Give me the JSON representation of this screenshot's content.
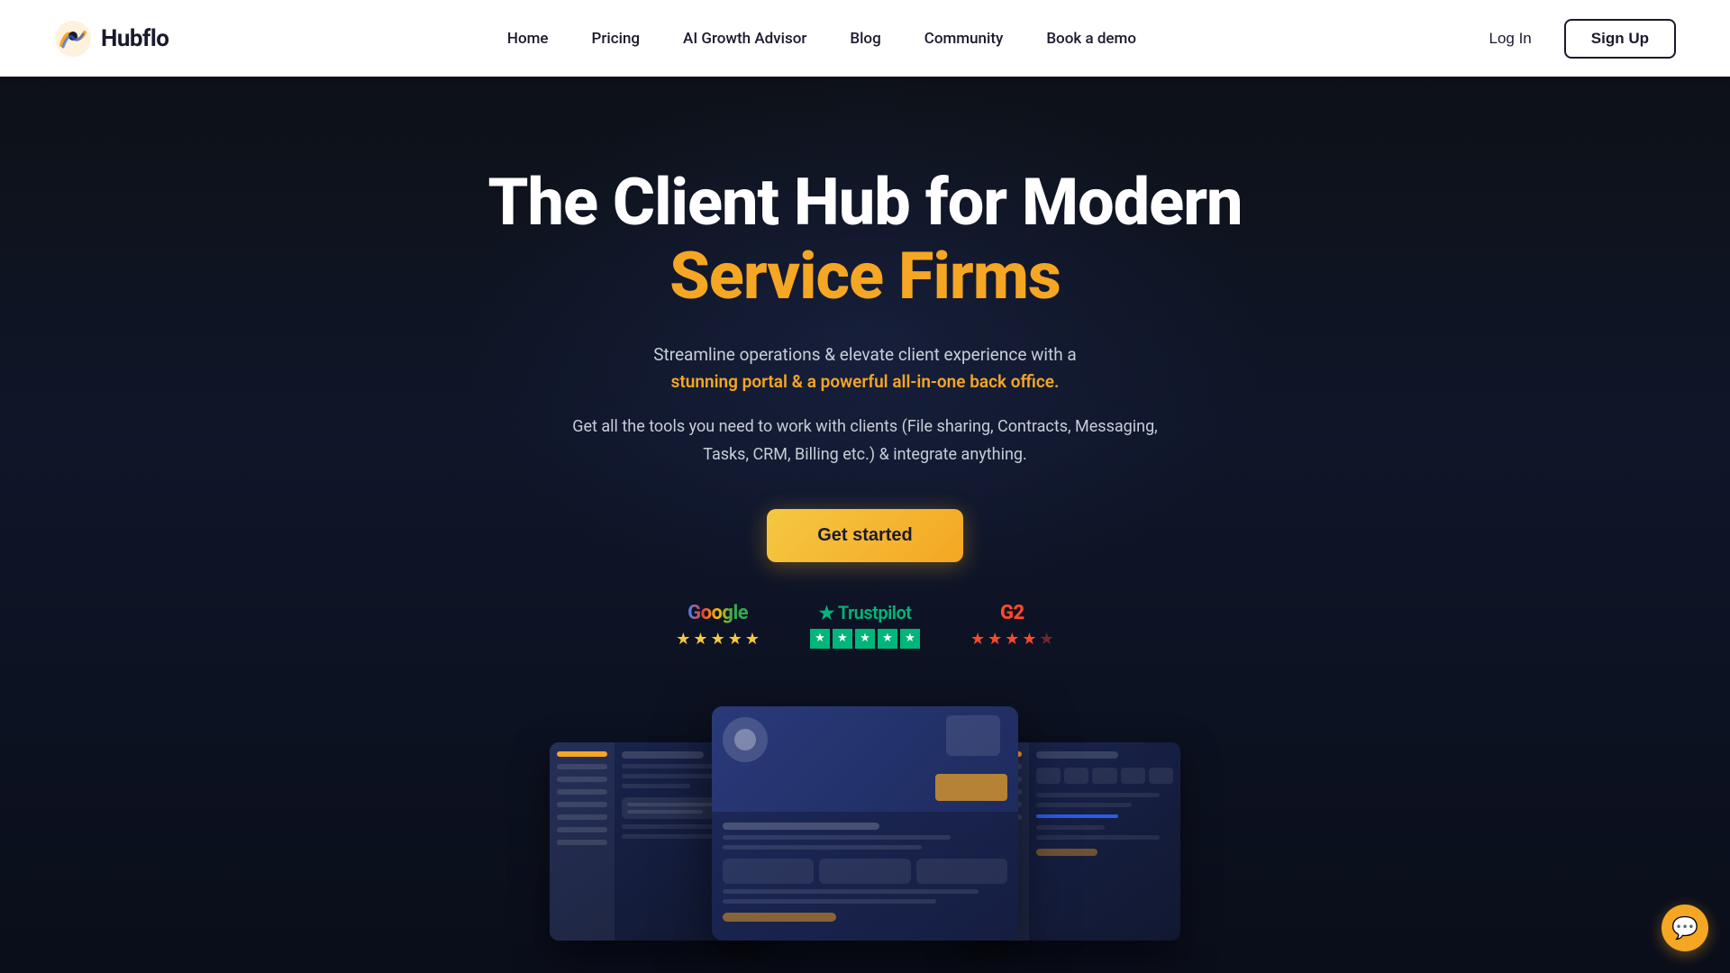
{
  "navbar": {
    "logo_text": "Hubflo",
    "nav_items": [
      {
        "label": "Home",
        "id": "home"
      },
      {
        "label": "Pricing",
        "id": "pricing"
      },
      {
        "label": "AI Growth Advisor",
        "id": "ai-growth"
      },
      {
        "label": "Blog",
        "id": "blog"
      },
      {
        "label": "Community",
        "id": "community"
      },
      {
        "label": "Book a demo",
        "id": "book-demo"
      }
    ],
    "login_label": "Log In",
    "signup_label": "Sign Up"
  },
  "hero": {
    "title_line1": "The Client Hub for Modern",
    "title_line2": "Service Firms",
    "subtitle_plain": "Streamline operations & elevate client experience with a",
    "subtitle_accent": "stunning portal & a powerful all-in-one back office.",
    "description": "Get all the tools you need to work with clients (File sharing, Contracts, Messaging, Tasks, CRM, Billing etc.) & integrate anything.",
    "cta_label": "Get started",
    "ratings": [
      {
        "id": "google",
        "name": "Google",
        "stars": 5,
        "type": "gold"
      },
      {
        "id": "trustpilot",
        "name": "Trustpilot",
        "stars": 5,
        "type": "green"
      },
      {
        "id": "g2",
        "name": "G2",
        "stars": 4.5,
        "type": "orange"
      }
    ]
  },
  "chat": {
    "icon": "💬"
  }
}
